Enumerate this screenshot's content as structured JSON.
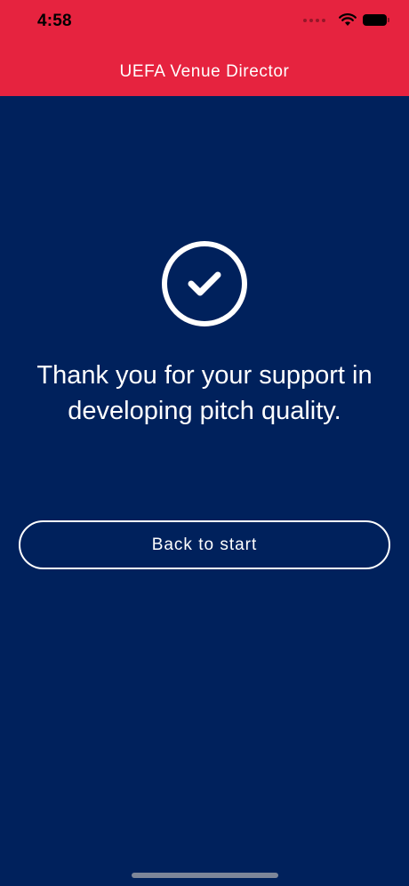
{
  "status_bar": {
    "time": "4:58",
    "wifi_icon": "wifi-icon",
    "battery_icon": "battery-icon"
  },
  "header": {
    "title": "UEFA Venue Director",
    "background_color": "#e6233f"
  },
  "main": {
    "background_color": "#00215c",
    "success_icon": "check-circle-icon",
    "message": "Thank you for your support in developing pitch quality.",
    "back_button_label": "Back to start"
  }
}
